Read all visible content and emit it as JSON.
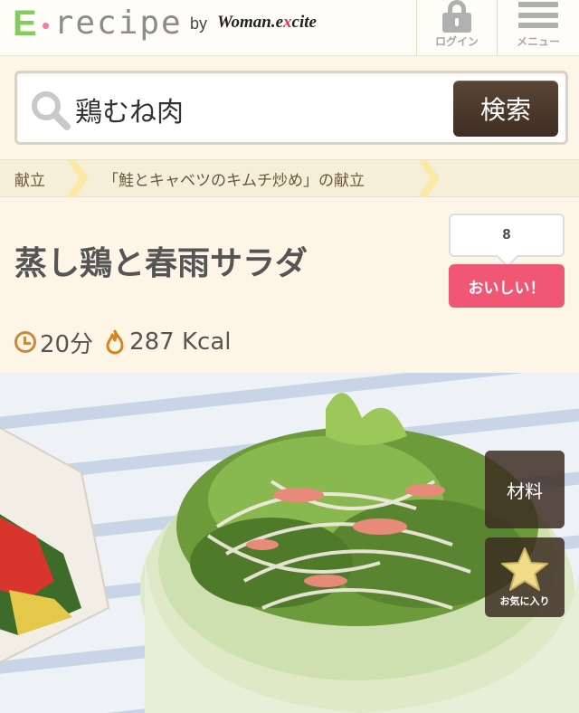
{
  "header": {
    "logo_letter": "E",
    "logo_word": "recipe",
    "logo_by": "by",
    "logo_brand_a": "Woman.e",
    "logo_brand_x": "x",
    "logo_brand_b": "cite",
    "login_label": "ログイン",
    "menu_label": "メニュー",
    "icons": [
      "lock-icon",
      "menu-icon"
    ]
  },
  "search": {
    "value": "鶏むね肉",
    "button_label": "検索",
    "icon": "search-icon"
  },
  "breadcrumb": {
    "items": [
      "献立",
      "「鮭とキャベツのキムチ炒め」の献立"
    ]
  },
  "recipe": {
    "title": "蒸し鶏と春雨サラダ",
    "like_count": "8",
    "like_label": "おいしい！",
    "time": "20分",
    "calories": "287 Kcal",
    "icons": [
      "clock-icon",
      "fire-icon"
    ]
  },
  "photo": {
    "ingredients_label": "材料",
    "favorite_label": "お気に入り",
    "icons": [
      "star-icon"
    ]
  },
  "colors": {
    "background": "#fdf6e6",
    "search_button": "#4a3628",
    "like_button": "#ef5774",
    "logo_green": "#7fcf5a",
    "logo_pink": "#f27aa6"
  }
}
